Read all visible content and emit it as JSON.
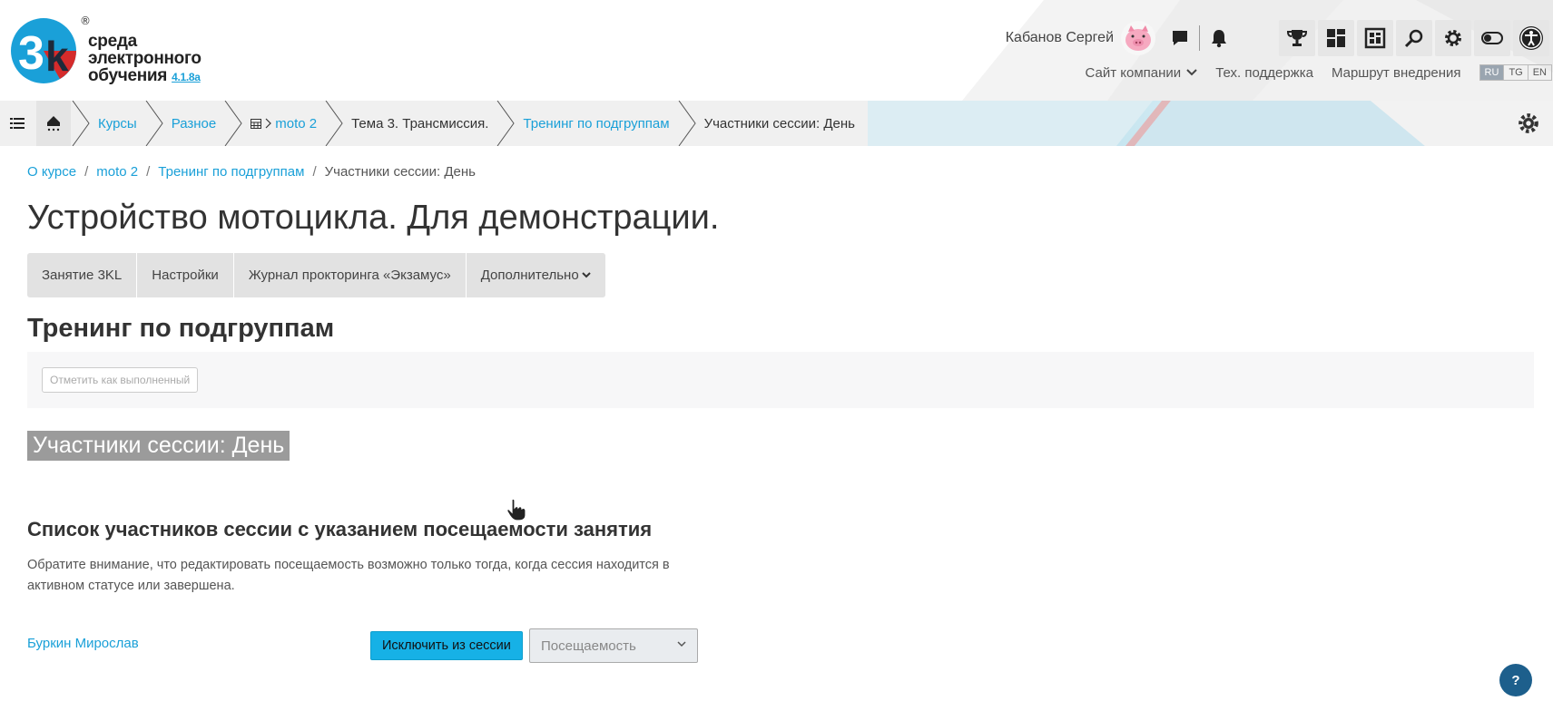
{
  "logo": {
    "line1": "среда",
    "line2": "электронного",
    "line3": "обучения",
    "version": "4.1.8a",
    "registered": "®"
  },
  "user": {
    "name": "Кабанов Сергей"
  },
  "top_links": {
    "company_site": "Сайт компании",
    "support": "Тех. поддержка",
    "route": "Маршрут внедрения"
  },
  "languages": [
    "RU",
    "TG",
    "EN"
  ],
  "navbar": {
    "crumbs": [
      "Курсы",
      "Разное",
      "moto 2",
      "Тема 3. Трансмиссия.",
      "Тренинг по подгруппам",
      "Участники сессии: День"
    ]
  },
  "breadcrumb": {
    "items": [
      "О курсе",
      "moto 2",
      "Тренинг по подгруппам",
      "Участники сессии: День"
    ],
    "separator": "/"
  },
  "course_title": "Устройство мотоцикла. Для демонстрации.",
  "tabs": [
    "Занятие 3KL",
    "Настройки",
    "Журнал прокторинга «Экзамус»",
    "Дополнительно"
  ],
  "activity_title": "Тренинг по подгруппам",
  "completion": {
    "mark_label": "Отметить как выполненный"
  },
  "session_title": "Участники сессии: День",
  "list_title": "Список участников сессии с указанием посещаемости занятия",
  "notice": "Обратите внимание, что редактировать посещаемость возможно только тогда, когда сессия находится в активном статусе или завершена.",
  "participants": [
    {
      "name": "Буркин Мирослав",
      "exclude_label": "Исключить из сессии",
      "attendance_value": "Посещаемость"
    }
  ],
  "help": "?",
  "colors": {
    "link": "#1aa0d8",
    "primary_button": "#16b1e6",
    "help": "#1d5f8c",
    "session_badge": "#9b9b9b"
  }
}
